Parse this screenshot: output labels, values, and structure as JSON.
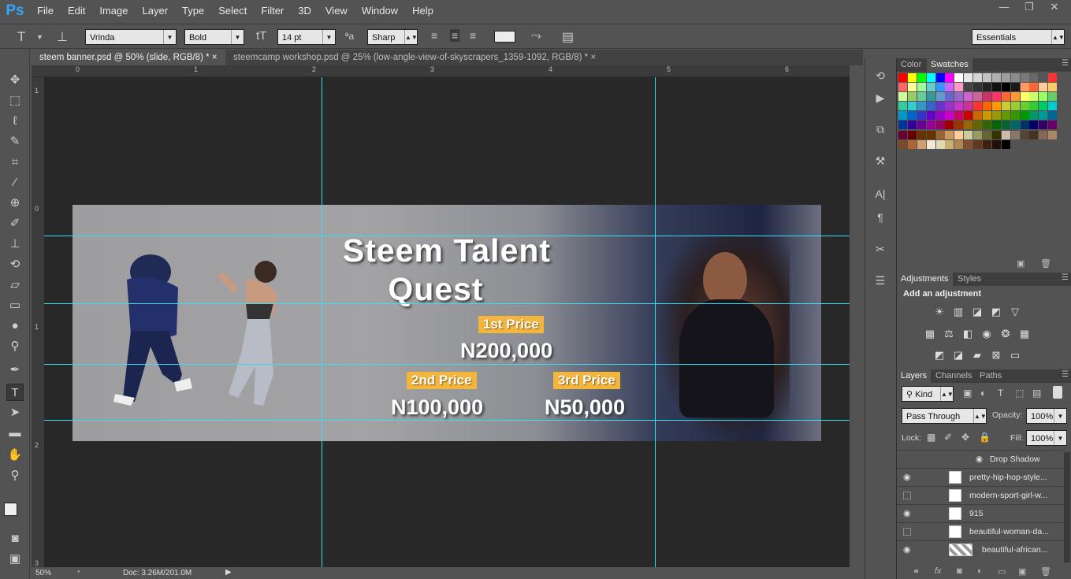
{
  "app": {
    "logo": "Ps"
  },
  "menu": [
    "File",
    "Edit",
    "Image",
    "Layer",
    "Type",
    "Select",
    "Filter",
    "3D",
    "View",
    "Window",
    "Help"
  ],
  "window_controls": {
    "minimize": "—",
    "restore": "❐",
    "close": "✕"
  },
  "options_bar": {
    "font_family": "Vrinda",
    "font_style": "Bold",
    "font_size": "14 pt",
    "antialias": "Sharp",
    "workspace": "Essentials"
  },
  "tabs": [
    {
      "label": "steem banner.psd @ 50% (slide, RGB/8) *",
      "close": "×",
      "active": true
    },
    {
      "label": "steemcamp workshop.psd @ 25% (low-angle-view-of-skyscrapers_1359-1092, RGB/8) *",
      "close": "×",
      "active": false
    }
  ],
  "ruler": {
    "h_ticks": [
      "0",
      "1",
      "2",
      "3",
      "4",
      "5",
      "6"
    ],
    "v_ticks": [
      "1",
      "0",
      "1",
      "2",
      "3"
    ]
  },
  "banner": {
    "title_line1": "Steem Talent",
    "title_line2": "Quest",
    "prize1_label": "1st Price",
    "prize1_amount": "N200,000",
    "prize2_label": "2nd Price",
    "prize2_amount": "N100,000",
    "prize3_label": "3rd Price",
    "prize3_amount": "N50,000"
  },
  "status": {
    "zoom": "50%",
    "doc": "Doc: 3.26M/201.0M"
  },
  "panels": {
    "color_tabs": [
      "Color",
      "Swatches"
    ],
    "adjust_tabs": [
      "Adjustments",
      "Styles"
    ],
    "adjust_hint": "Add an adjustment",
    "layers_tabs": [
      "Layers",
      "Channels",
      "Paths"
    ],
    "kind_filter": "Kind",
    "blend_mode": "Pass Through",
    "opacity_label": "Opacity:",
    "opacity_value": "100%",
    "lock_label": "Lock:",
    "fill_label": "Fill:",
    "fill_value": "100%",
    "layers": [
      {
        "name": "Drop Shadow",
        "visible": true,
        "effect": true
      },
      {
        "name": "pretty-hip-hop-style...",
        "visible": true
      },
      {
        "name": "modern-sport-girl-w...",
        "visible": false
      },
      {
        "name": "915",
        "visible": true
      },
      {
        "name": "beautiful-woman-da...",
        "visible": false
      },
      {
        "name": "beautiful-african...",
        "visible": true
      }
    ]
  },
  "swatch_colors": [
    "#ff0000",
    "#ffff00",
    "#00ff00",
    "#00ffff",
    "#0000ff",
    "#ff00ff",
    "#ffffff",
    "#e6e6e6",
    "#d4d4d4",
    "#c2c2c2",
    "#b0b0b0",
    "#9e9e9e",
    "#8c8c8c",
    "#7a7a7a",
    "#686868",
    "#565656",
    "#ff3333",
    "#ff6666",
    "#ffff99",
    "#99ff99",
    "#66cccc",
    "#3399ff",
    "#cc66ff",
    "#ff99cc",
    "#444444",
    "#333333",
    "#222222",
    "#111111",
    "#000000",
    "#1a1a1a",
    "#ff9966",
    "#ff6633",
    "#ffcc99",
    "#ffcc66",
    "#ccff99",
    "#99cc66",
    "#66cc99",
    "#339999",
    "#6699cc",
    "#6666cc",
    "#9966cc",
    "#cc66cc",
    "#cc6699",
    "#cc3366",
    "#ff3366",
    "#ff6633",
    "#ff9933",
    "#ffff66",
    "#ccff66",
    "#99ff66",
    "#66cc66",
    "#33cc99",
    "#33cccc",
    "#3399cc",
    "#3366cc",
    "#6633cc",
    "#9933cc",
    "#cc33cc",
    "#cc3399",
    "#ff3333",
    "#ff6600",
    "#ff9900",
    "#cccc33",
    "#99cc33",
    "#66cc33",
    "#33cc33",
    "#00cc66",
    "#00cccc",
    "#0099cc",
    "#0066cc",
    "#3333cc",
    "#6600cc",
    "#9900cc",
    "#cc00cc",
    "#cc0066",
    "#cc0000",
    "#cc6600",
    "#cc9900",
    "#999900",
    "#669900",
    "#339900",
    "#009900",
    "#009966",
    "#009999",
    "#006699",
    "#003399",
    "#330099",
    "#660099",
    "#990099",
    "#990066",
    "#990000",
    "#993300",
    "#996600",
    "#666600",
    "#336600",
    "#006600",
    "#006633",
    "#006666",
    "#003366",
    "#000066",
    "#330066",
    "#660066",
    "#660033",
    "#660000",
    "#663300",
    "#663300",
    "#996633",
    "#cc9966",
    "#ffcc99",
    "#cccc99",
    "#999966",
    "#666633",
    "#333300",
    "#ccbbaa",
    "#887766",
    "#554433",
    "#443322",
    "#886655",
    "#aa8866",
    "#7b4a2a",
    "#aa6633",
    "#d0a070",
    "#f0e8d0",
    "#e0d8b0",
    "#c8b070",
    "#b08850",
    "#805030",
    "#603820",
    "#402010",
    "#201008",
    "#000000"
  ]
}
